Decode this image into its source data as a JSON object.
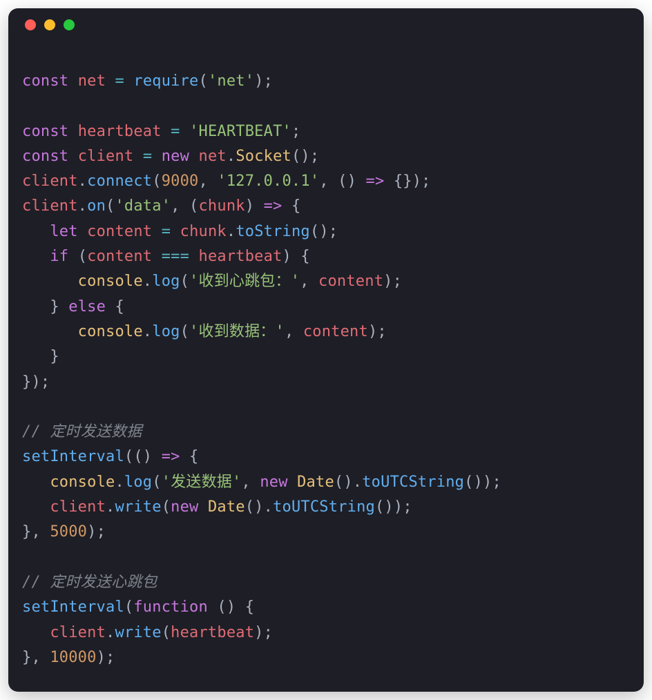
{
  "titlebar": {
    "dots": [
      "red",
      "yellow",
      "green"
    ]
  },
  "tokens": {
    "const": "const",
    "let": "let",
    "new": "new",
    "if": "if",
    "else": "else",
    "function": "function",
    "net": "net",
    "heartbeat": "heartbeat",
    "client": "client",
    "content": "content",
    "chunk": "chunk",
    "console": "console",
    "require": "require",
    "connect": "connect",
    "on": "on",
    "log": "log",
    "toString": "toString",
    "write": "write",
    "setInterval": "setInterval",
    "toUTCString": "toUTCString",
    "Socket": "Socket",
    "Date": "Date",
    "eq": "=",
    "eqeqeq": "===",
    "arrow": "=>",
    "str_net": "'net'",
    "str_HEARTBEAT": "'HEARTBEAT'",
    "str_127": "'127.0.0.1'",
    "str_data": "'data'",
    "str_heartbeat_recv": "'收到心跳包：'",
    "str_data_recv": "'收到数据：'",
    "str_send_data": "'发送数据'",
    "num_9000": "9000",
    "num_5000": "5000",
    "num_10000": "10000",
    "cmt_send_data": "// 定时发送数据",
    "cmt_send_hb": "// 定时发送心跳包"
  }
}
